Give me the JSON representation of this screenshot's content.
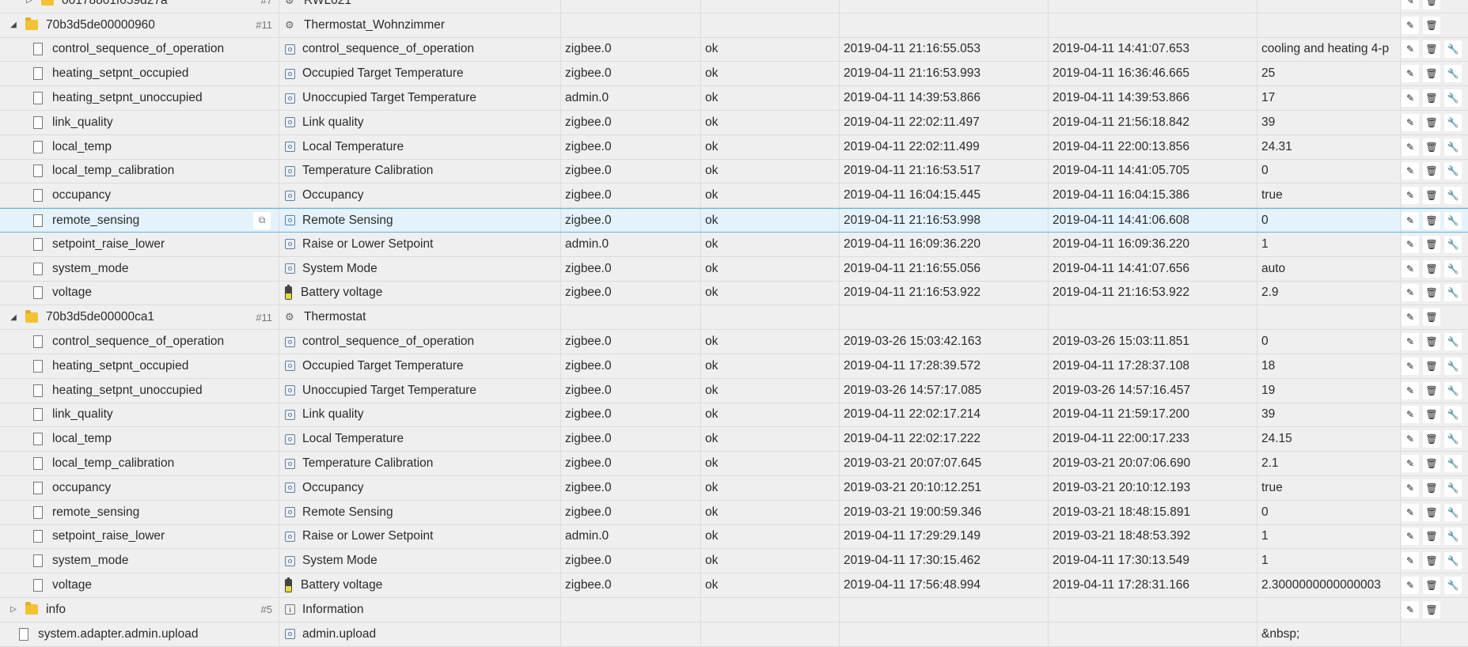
{
  "rows": [
    {
      "type": "folder",
      "indent": 30,
      "expander": "▷",
      "id": "00178801f059d27a",
      "count": "#7",
      "icon": "device",
      "name": "RWL021",
      "role": "",
      "status": "",
      "ts": "",
      "lc": "",
      "val": "",
      "buttons": 2
    },
    {
      "type": "folder",
      "indent": 10,
      "expander": "◢",
      "id": "70b3d5de00000960",
      "count": "#11",
      "icon": "device",
      "name": "Thermostat_Wohnzimmer",
      "role": "",
      "status": "",
      "ts": "",
      "lc": "",
      "val": "",
      "buttons": 2
    },
    {
      "type": "state",
      "id": "control_sequence_of_operation",
      "name": "control_sequence_of_operation",
      "role": "zigbee.0",
      "status": "ok",
      "ts": "2019-04-11 21:16:55.053",
      "lc": "2019-04-11 14:41:07.653",
      "val": "cooling and heating 4-p"
    },
    {
      "type": "state",
      "id": "heating_setpnt_occupied",
      "name": "Occupied Target Temperature",
      "role": "zigbee.0",
      "status": "ok",
      "ts": "2019-04-11 21:16:53.993",
      "lc": "2019-04-11 16:36:46.665",
      "val": "25"
    },
    {
      "type": "state",
      "id": "heating_setpnt_unoccupied",
      "name": "Unoccupied Target Temperature",
      "role": "admin.0",
      "status": "ok",
      "ts": "2019-04-11 14:39:53.866",
      "lc": "2019-04-11 14:39:53.866",
      "val": "17"
    },
    {
      "type": "state",
      "id": "link_quality",
      "name": "Link quality",
      "role": "zigbee.0",
      "status": "ok",
      "ts": "2019-04-11 22:02:11.497",
      "lc": "2019-04-11 21:56:18.842",
      "val": "39"
    },
    {
      "type": "state",
      "id": "local_temp",
      "name": "Local Temperature",
      "role": "zigbee.0",
      "status": "ok",
      "ts": "2019-04-11 22:02:11.499",
      "lc": "2019-04-11 22:00:13.856",
      "val": "24.31"
    },
    {
      "type": "state",
      "id": "local_temp_calibration",
      "name": "Temperature Calibration",
      "role": "zigbee.0",
      "status": "ok",
      "ts": "2019-04-11 21:16:53.517",
      "lc": "2019-04-11 14:41:05.705",
      "val": "0"
    },
    {
      "type": "state",
      "id": "occupancy",
      "name": "Occupancy",
      "role": "zigbee.0",
      "status": "ok",
      "ts": "2019-04-11 16:04:15.445",
      "lc": "2019-04-11 16:04:15.386",
      "val": "true"
    },
    {
      "type": "state",
      "selected": true,
      "id": "remote_sensing",
      "name": "Remote Sensing",
      "role": "zigbee.0",
      "status": "ok",
      "ts": "2019-04-11 21:16:53.998",
      "lc": "2019-04-11 14:41:06.608",
      "val": "0"
    },
    {
      "type": "state",
      "id": "setpoint_raise_lower",
      "name": "Raise or Lower Setpoint",
      "role": "admin.0",
      "status": "ok",
      "ts": "2019-04-11 16:09:36.220",
      "lc": "2019-04-11 16:09:36.220",
      "val": "1"
    },
    {
      "type": "state",
      "id": "system_mode",
      "name": "System Mode",
      "role": "zigbee.0",
      "status": "ok",
      "ts": "2019-04-11 21:16:55.056",
      "lc": "2019-04-11 14:41:07.656",
      "val": "auto"
    },
    {
      "type": "state",
      "icon": "battery",
      "id": "voltage",
      "name": "Battery voltage",
      "role": "zigbee.0",
      "status": "ok",
      "ts": "2019-04-11 21:16:53.922",
      "lc": "2019-04-11 21:16:53.922",
      "val": "2.9"
    },
    {
      "type": "folder",
      "indent": 10,
      "expander": "◢",
      "id": "70b3d5de00000ca1",
      "count": "#11",
      "icon": "device",
      "name": "Thermostat",
      "role": "",
      "status": "",
      "ts": "",
      "lc": "",
      "val": "",
      "buttons": 2
    },
    {
      "type": "state",
      "id": "control_sequence_of_operation",
      "name": "control_sequence_of_operation",
      "role": "zigbee.0",
      "status": "ok",
      "ts": "2019-03-26 15:03:42.163",
      "lc": "2019-03-26 15:03:11.851",
      "val": "0"
    },
    {
      "type": "state",
      "id": "heating_setpnt_occupied",
      "name": "Occupied Target Temperature",
      "role": "zigbee.0",
      "status": "ok",
      "ts": "2019-04-11 17:28:39.572",
      "lc": "2019-04-11 17:28:37.108",
      "val": "18"
    },
    {
      "type": "state",
      "id": "heating_setpnt_unoccupied",
      "name": "Unoccupied Target Temperature",
      "role": "zigbee.0",
      "status": "ok",
      "ts": "2019-03-26 14:57:17.085",
      "lc": "2019-03-26 14:57:16.457",
      "val": "19"
    },
    {
      "type": "state",
      "id": "link_quality",
      "name": "Link quality",
      "role": "zigbee.0",
      "status": "ok",
      "ts": "2019-04-11 22:02:17.214",
      "lc": "2019-04-11 21:59:17.200",
      "val": "39"
    },
    {
      "type": "state",
      "id": "local_temp",
      "name": "Local Temperature",
      "role": "zigbee.0",
      "status": "ok",
      "ts": "2019-04-11 22:02:17.222",
      "lc": "2019-04-11 22:00:17.233",
      "val": "24.15"
    },
    {
      "type": "state",
      "id": "local_temp_calibration",
      "name": "Temperature Calibration",
      "role": "zigbee.0",
      "status": "ok",
      "ts": "2019-03-21 20:07:07.645",
      "lc": "2019-03-21 20:07:06.690",
      "val": "2.1"
    },
    {
      "type": "state",
      "id": "occupancy",
      "name": "Occupancy",
      "role": "zigbee.0",
      "status": "ok",
      "ts": "2019-03-21 20:10:12.251",
      "lc": "2019-03-21 20:10:12.193",
      "val": "true"
    },
    {
      "type": "state",
      "id": "remote_sensing",
      "name": "Remote Sensing",
      "role": "zigbee.0",
      "status": "ok",
      "ts": "2019-03-21 19:00:59.346",
      "lc": "2019-03-21 18:48:15.891",
      "val": "0"
    },
    {
      "type": "state",
      "id": "setpoint_raise_lower",
      "name": "Raise or Lower Setpoint",
      "role": "admin.0",
      "status": "ok",
      "ts": "2019-04-11 17:29:29.149",
      "lc": "2019-03-21 18:48:53.392",
      "val": "1"
    },
    {
      "type": "state",
      "id": "system_mode",
      "name": "System Mode",
      "role": "zigbee.0",
      "status": "ok",
      "ts": "2019-04-11 17:30:15.462",
      "lc": "2019-04-11 17:30:13.549",
      "val": "1"
    },
    {
      "type": "state",
      "icon": "battery",
      "id": "voltage",
      "name": "Battery voltage",
      "role": "zigbee.0",
      "status": "ok",
      "ts": "2019-04-11 17:56:48.994",
      "lc": "2019-04-11 17:28:31.166",
      "val": "2.3000000000000003"
    },
    {
      "type": "folder",
      "indent": 10,
      "expander": "▷",
      "id": "info",
      "count": "#5",
      "icon": "info",
      "name": "Information",
      "role": "",
      "status": "",
      "ts": "",
      "lc": "",
      "val": "",
      "buttons": 2
    },
    {
      "type": "file",
      "id": "system.adapter.admin.upload",
      "name": "admin.upload",
      "role": "",
      "status": "",
      "ts": "",
      "lc": "",
      "val": "&nbsp;"
    }
  ],
  "icons": {
    "edit": "✎",
    "delete": "🗑",
    "wrench": "🔧",
    "copy": "⧉",
    "info": "i",
    "device": "⚙"
  }
}
